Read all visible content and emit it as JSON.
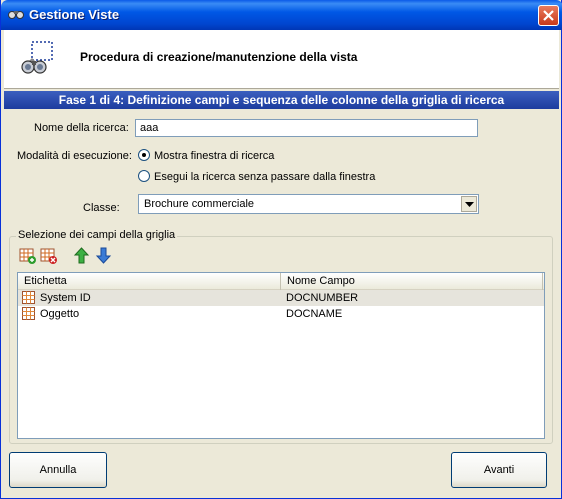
{
  "window": {
    "title": "Gestione Viste"
  },
  "header": {
    "text": "Procedura di creazione/manutenzione della vista"
  },
  "banner": {
    "text": "Fase 1 di 4: Definizione campi e sequenza delle colonne della griglia di ricerca"
  },
  "form": {
    "search_name_label": "Nome della ricerca:",
    "search_name_value": "aaa",
    "mode_label": "Modalità di esecuzione:",
    "mode_option_1": "Mostra finestra di ricerca",
    "mode_option_2": "Esegui la ricerca senza passare dalla finestra",
    "selected_mode": "Mostra finestra di ricerca",
    "class_label": "Classe:",
    "class_value": "Brochure commerciale"
  },
  "fields_group": {
    "title": "Selezione dei campi della griglia",
    "toolbar": [
      "add-field-icon",
      "remove-field-icon",
      "move-up-icon",
      "move-down-icon"
    ],
    "columns": [
      "Etichetta",
      "Nome Campo"
    ],
    "rows": [
      {
        "label": "System ID",
        "field": "DOCNUMBER"
      },
      {
        "label": "Oggetto",
        "field": "DOCNAME"
      }
    ]
  },
  "buttons": {
    "cancel": "Annulla",
    "next": "Avanti"
  }
}
